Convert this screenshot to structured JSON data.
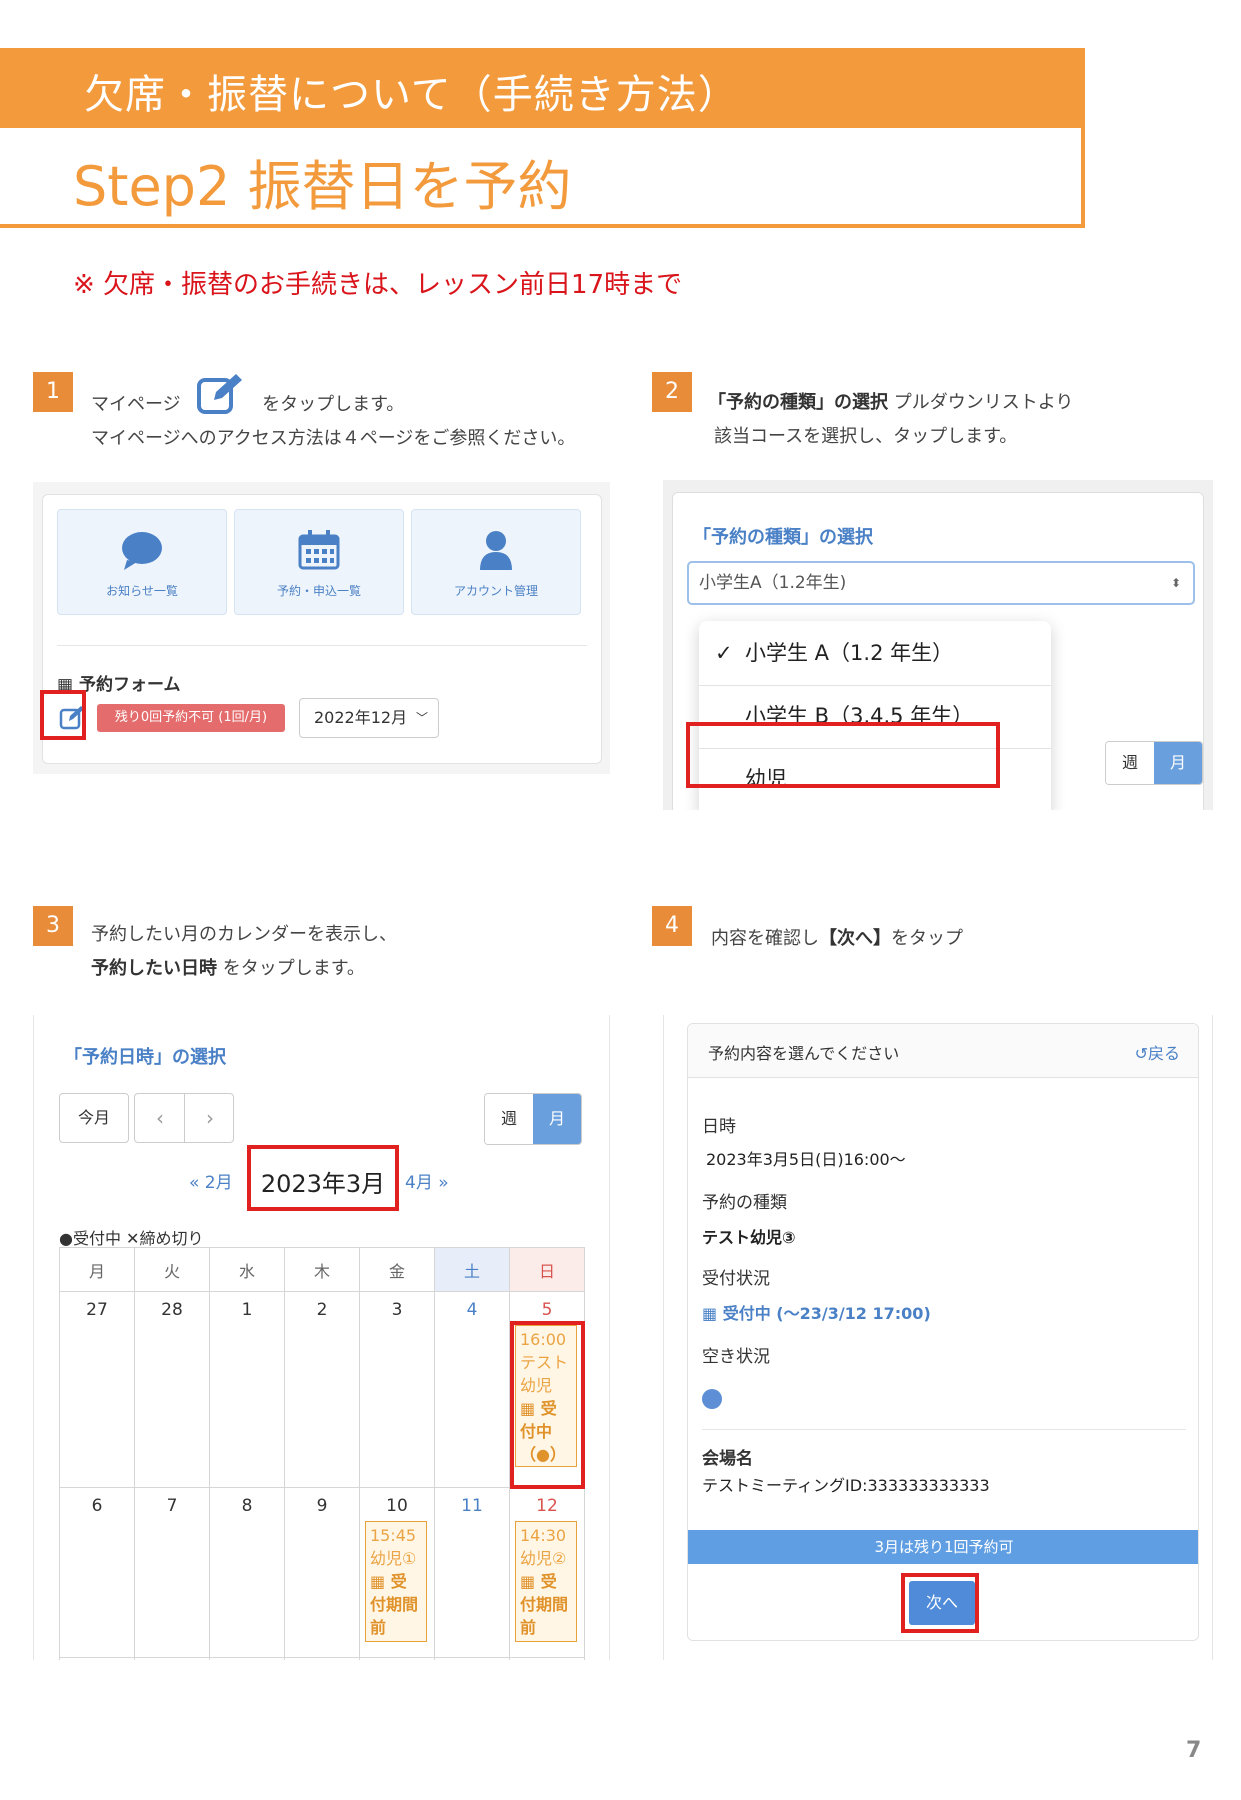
{
  "header": {
    "category": "欠席・振替について（手続き方法）",
    "title": "Step2 振替日を予約",
    "notice": "※ 欠席・振替のお手続きは、レッスン前日17時まで"
  },
  "steps": {
    "s1": {
      "num": "1",
      "line1a": "マイページ",
      "line1b": "をタップします。",
      "line2": "マイページへのアクセス方法は４ページをご参照ください。"
    },
    "s2": {
      "num": "2",
      "line1b": "「予約の種類」の選択",
      "line1c": " プルダウンリストより",
      "line2": "該当コースを選択し、タップします。"
    },
    "s3": {
      "num": "3",
      "line1": "予約したい月のカレンダーを表示し、",
      "line2b": "予約したい日時",
      "line2c": " をタップします。"
    },
    "s4": {
      "num": "4",
      "line1a": "内容を確認し",
      "line1b": "【次へ】",
      "line1c": "をタップ"
    }
  },
  "panel1": {
    "tiles": [
      "お知らせ一覧",
      "予約・申込一覧",
      "アカウント管理"
    ],
    "form_title": "予約フォーム",
    "badge": "残り0回予約不可 (1回/月)",
    "month_select": "2022年12月"
  },
  "panel2": {
    "title": "「予約の種類」の選択",
    "select_value": "小学生A（1.2年生)",
    "options": [
      "小学生 A（1.2 年生）",
      "小学生 B（3.4.5 年生）",
      "幼児"
    ],
    "checkmark": "✓",
    "week": "週",
    "month": "月"
  },
  "panel3": {
    "title": "「予約日時」の選択",
    "today": "今月",
    "prev_month": "« 2月",
    "current_month": "2023年3月",
    "next_month": "4月 »",
    "legend": "●受付中 ✕締め切り",
    "week": "週",
    "month": "月",
    "weekdays": [
      "月",
      "火",
      "水",
      "木",
      "金",
      "土",
      "日"
    ],
    "row1": [
      "27",
      "28",
      "1",
      "2",
      "3",
      "4",
      "5"
    ],
    "row2": [
      "6",
      "7",
      "8",
      "9",
      "10",
      "11",
      "12"
    ],
    "events": {
      "mar5": {
        "time": "16:00",
        "name": "テスト幼児",
        "status": "受付中（●）"
      },
      "mar10": {
        "time": "15:45",
        "name": "幼児①",
        "status": "受付期間前"
      },
      "mar12": {
        "time": "14:30",
        "name": "幼児②",
        "status": "受付期間前"
      }
    }
  },
  "panel4": {
    "header": "予約内容を選んでください",
    "back": "戻る",
    "date_label": "日時",
    "date_value": "2023年3月5日(日)16:00〜",
    "type_label": "予約の種類",
    "type_value": "テスト幼児③",
    "status_label": "受付状況",
    "status_value": "受付中 (〜23/3/12 17:00)",
    "vacancy_label": "空き状況",
    "venue_label": "会場名",
    "venue_value": "テストミーティングID:333333333333",
    "remaining": "3月は残り1回予約可",
    "next": "次へ"
  },
  "page_number": "7",
  "colors": {
    "accent": "#f29a3c",
    "alert": "#d9141b",
    "link": "#4a80c6",
    "highlight": "#e0211f"
  }
}
